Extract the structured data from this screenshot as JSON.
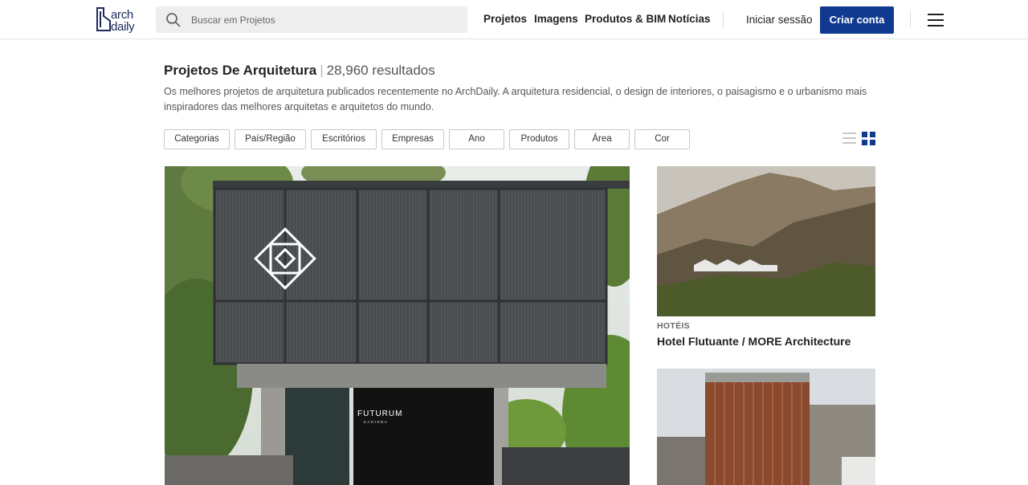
{
  "header": {
    "logo_text": "arch\ndaily",
    "search_placeholder": "Buscar em Projetos",
    "nav": [
      "Projetos",
      "Imagens",
      "Produtos & BIM",
      "Notícias"
    ],
    "login_label": "Iniciar sessão",
    "signup_label": "Criar conta",
    "accent_color": "#0f3a8f"
  },
  "page": {
    "title": "Projetos De Arquitetura",
    "results": "28,960 resultados",
    "description": "Os melhores projetos de arquitetura publicados recentemente no ArchDaily. A arquitetura residencial, o design de interiores, o paisagismo e o urbanismo mais inspiradores das melhores arquitetas e arquitetos do mundo."
  },
  "filters": [
    "Categorias",
    "País/Região",
    "Escritórios",
    "Empresas",
    "Ano",
    "Produtos",
    "Área",
    "Cor"
  ],
  "main_project": {
    "sign_text": "FUTURUM",
    "sign_sub": "KARIRBA"
  },
  "side_projects": [
    {
      "category": "HOTÉIS",
      "title": "Hotel Flutuante / MORE Architecture"
    },
    {
      "category": "",
      "title": ""
    }
  ]
}
